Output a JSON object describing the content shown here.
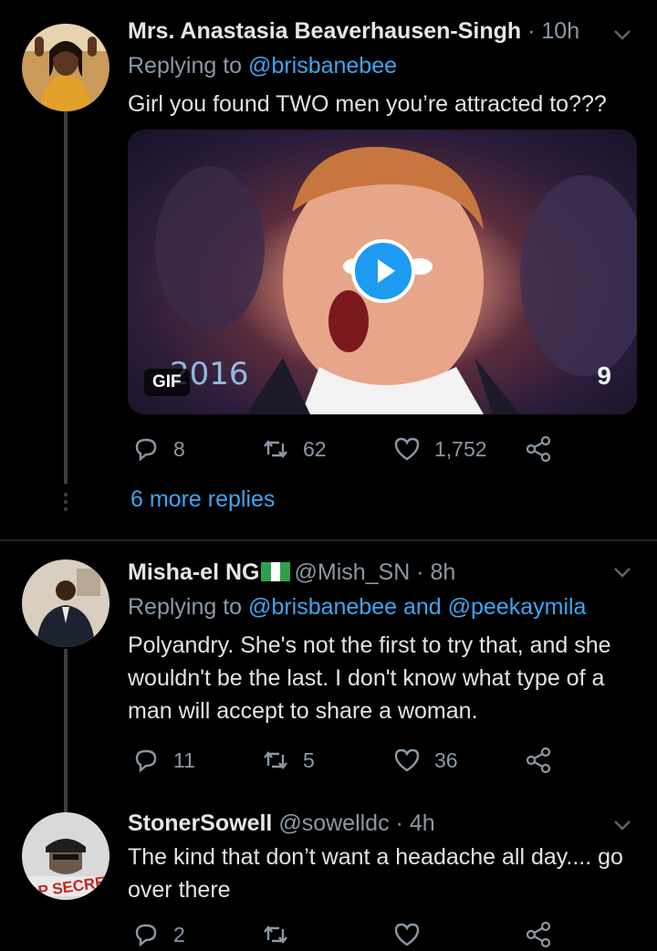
{
  "tweets": [
    {
      "name": "Mrs. Anastasia Beaverhausen-Singh",
      "time": "10h",
      "replying_label": "Replying to",
      "replying_to": "@brisbanebee",
      "text": "Girl you found TWO men you’re attracted to???",
      "media": {
        "badge": "GIF",
        "watermark_year": "2016",
        "watermark_channel": "9"
      },
      "stats": {
        "replies": "8",
        "retweets": "62",
        "likes": "1,752"
      },
      "more_replies": "6 more replies"
    },
    {
      "name": "Misha-el NG",
      "handle": "@Mish_SN",
      "time": "8h",
      "replying_label": "Replying to",
      "replying_to": "@brisbanebee and @peekaymila",
      "text": "Polyandry. She's not the first to try that, and she wouldn't be the last. I don't know what type of a man will accept to share a woman.",
      "stats": {
        "replies": "11",
        "retweets": "5",
        "likes": "36"
      }
    },
    {
      "name": "StonerSowell",
      "handle": "@sowelldc",
      "time": "4h",
      "text": "The kind that don’t want a headache all day.... go over there",
      "avatar_text": "OP SECRE",
      "stats": {
        "replies": "2"
      }
    }
  ],
  "colors": {
    "background": "#000000",
    "link": "#3ea6f2",
    "muted": "#8b98a5",
    "play_button": "#1d9bf0"
  },
  "icons": [
    "reply-icon",
    "retweet-icon",
    "like-icon",
    "share-icon",
    "chevron-down-icon",
    "play-icon"
  ]
}
